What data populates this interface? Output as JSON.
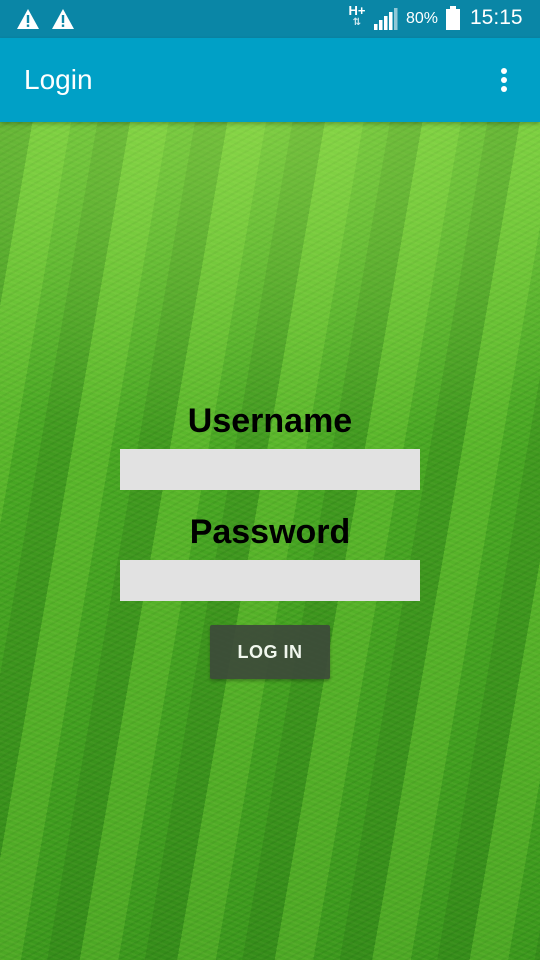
{
  "status_bar": {
    "network_label": "H+",
    "network_arrows": "⇅",
    "battery_percent": "80%",
    "time": "15:15",
    "icons": [
      "warning-icon",
      "warning-icon",
      "network-type-icon",
      "signal-icon",
      "battery-icon"
    ]
  },
  "app_bar": {
    "title": "Login",
    "menu_icon": "overflow-menu-icon"
  },
  "form": {
    "username_label": "Username",
    "username_value": "",
    "password_label": "Password",
    "password_value": "",
    "login_button_label": "LOG IN"
  },
  "colors": {
    "status_bar": "#0a86a6",
    "app_bar": "#00a0c6",
    "field_background": "#e2e2e2",
    "button_background": "#3d4a3a"
  }
}
